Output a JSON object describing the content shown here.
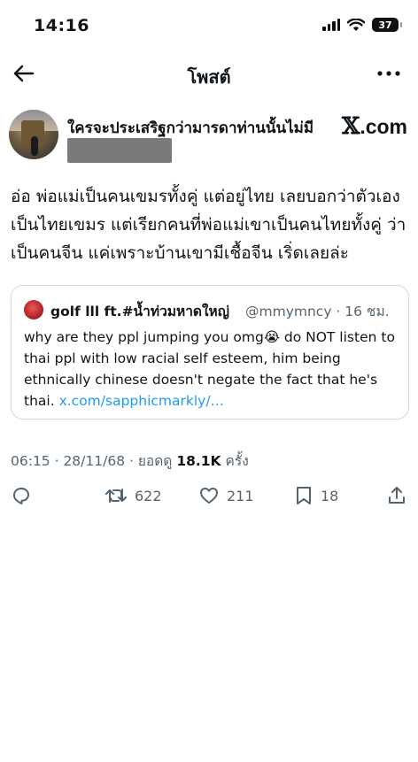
{
  "status_bar": {
    "time": "14:16",
    "battery": "37"
  },
  "nav": {
    "title": "โพสต์"
  },
  "author": {
    "display_name": "ใครจะประเสริฐกว่ามารดาท่านนั้นไม่มี",
    "brand_logo_x": "𝕏",
    "brand_logo_text": ".com"
  },
  "post": {
    "text": "อ่อ พ่อแม่เป็นคนเขมรทั้งคู่ แต่อยู่ไทย เลยบอกว่าตัวเองเป็นไทยเขมร แต่เรียกคนที่พ่อแม่เขาเป็นคนไทยทั้งคู่ ว่าเป็นคนจีน แค่เพราะบ้านเขามีเชื้อจีน เริ่ดเลยล่ะ"
  },
  "quote": {
    "name": "golf lll ft.#น้ำท่วมหาดใหญ่",
    "meta": "@mmymncy · 16 ชม.",
    "text": "why are they ppl jumping you omg😭 do NOT listen to thai ppl with low racial self esteem, him being ethnically chinese doesn't negate the fact that he's thai.",
    "link": "x.com/sapphicmarkly/…"
  },
  "timestamp": {
    "prefix": "06:15 · 28/11/68 · ยอดดู",
    "views": "18.1K",
    "suffix": "ครั้ง"
  },
  "actions": {
    "reposts": "622",
    "likes": "211",
    "bookmarks": "18"
  },
  "icons": {
    "back": "arrow-left-icon",
    "more": "more-horizontal-icon",
    "reply": "reply-icon",
    "repost": "repost-icon",
    "like": "heart-icon",
    "bookmark": "bookmark-icon",
    "share": "share-icon"
  },
  "colors": {
    "link": "#1d9bf0",
    "secondary_text": "#536471",
    "border": "#cfd9de"
  }
}
